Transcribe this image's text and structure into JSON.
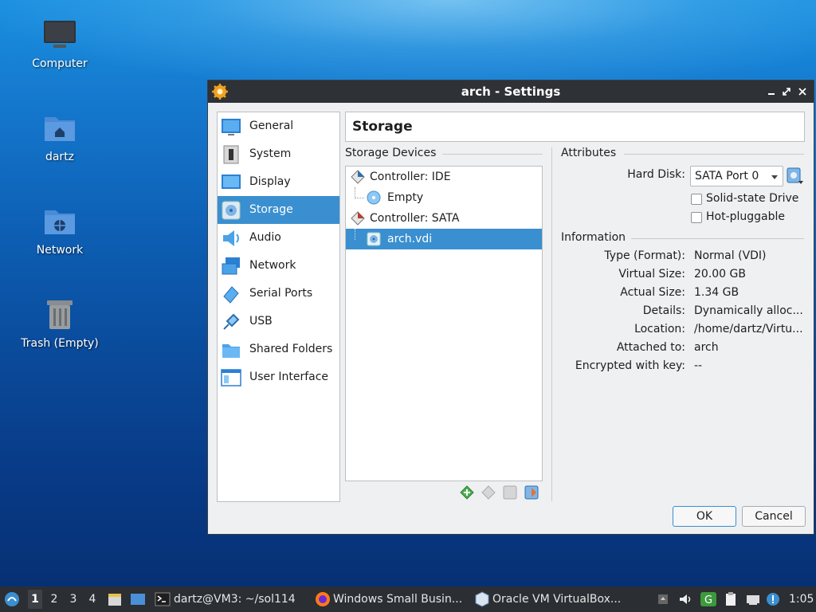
{
  "desktop": {
    "icons": [
      {
        "label": "Computer",
        "icon": "computer-icon"
      },
      {
        "label": "dartz",
        "icon": "home-folder-icon"
      },
      {
        "label": "Network",
        "icon": "network-folder-icon"
      },
      {
        "label": "Trash (Empty)",
        "icon": "trash-icon"
      }
    ]
  },
  "dialog": {
    "title": "arch - Settings",
    "icon": "virtualbox-gear-icon",
    "nav": [
      {
        "label": "General",
        "icon": "general-icon"
      },
      {
        "label": "System",
        "icon": "system-icon"
      },
      {
        "label": "Display",
        "icon": "display-icon"
      },
      {
        "label": "Storage",
        "icon": "storage-icon",
        "selected": true
      },
      {
        "label": "Audio",
        "icon": "audio-icon"
      },
      {
        "label": "Network",
        "icon": "network-icon"
      },
      {
        "label": "Serial Ports",
        "icon": "serial-ports-icon"
      },
      {
        "label": "USB",
        "icon": "usb-icon"
      },
      {
        "label": "Shared Folders",
        "icon": "shared-folders-icon"
      },
      {
        "label": "User Interface",
        "icon": "user-interface-icon"
      }
    ],
    "heading": "Storage",
    "storage_devices_label": "Storage Devices",
    "tree": [
      {
        "label": "Controller: IDE",
        "type": "controller"
      },
      {
        "label": "Empty",
        "type": "optical"
      },
      {
        "label": "Controller: SATA",
        "type": "controller"
      },
      {
        "label": "arch.vdi",
        "type": "disk",
        "selected": true
      }
    ],
    "attributes": {
      "label": "Attributes",
      "hard_disk_label": "Hard Disk:",
      "hard_disk_value": "SATA Port 0",
      "ssd_label": "Solid-state Drive",
      "hotplug_label": "Hot-pluggable"
    },
    "information": {
      "label": "Information",
      "rows": [
        {
          "key": "Type (Format):",
          "value": "Normal (VDI)"
        },
        {
          "key": "Virtual Size:",
          "value": "20.00 GB"
        },
        {
          "key": "Actual Size:",
          "value": "1.34 GB"
        },
        {
          "key": "Details:",
          "value": "Dynamically alloc..."
        },
        {
          "key": "Location:",
          "value": "/home/dartz/Virtu..."
        },
        {
          "key": "Attached to:",
          "value": "arch"
        },
        {
          "key": "Encrypted with key:",
          "value": "--"
        }
      ]
    },
    "ok_label": "OK",
    "cancel_label": "Cancel"
  },
  "taskbar": {
    "workspaces": [
      "1",
      "2",
      "3",
      "4"
    ],
    "tasks": [
      {
        "label": "dartz@VM3: ~/sol114",
        "icon": "terminal-icon"
      },
      {
        "label": "Windows Small Busin...",
        "icon": "firefox-icon"
      },
      {
        "label": "Oracle VM VirtualBox...",
        "icon": "virtualbox-icon"
      }
    ],
    "clock": "1:05"
  },
  "colors": {
    "selection": "#3a8fd0",
    "titlebar": "#2e3136",
    "taskbar": "#2b2e33"
  }
}
